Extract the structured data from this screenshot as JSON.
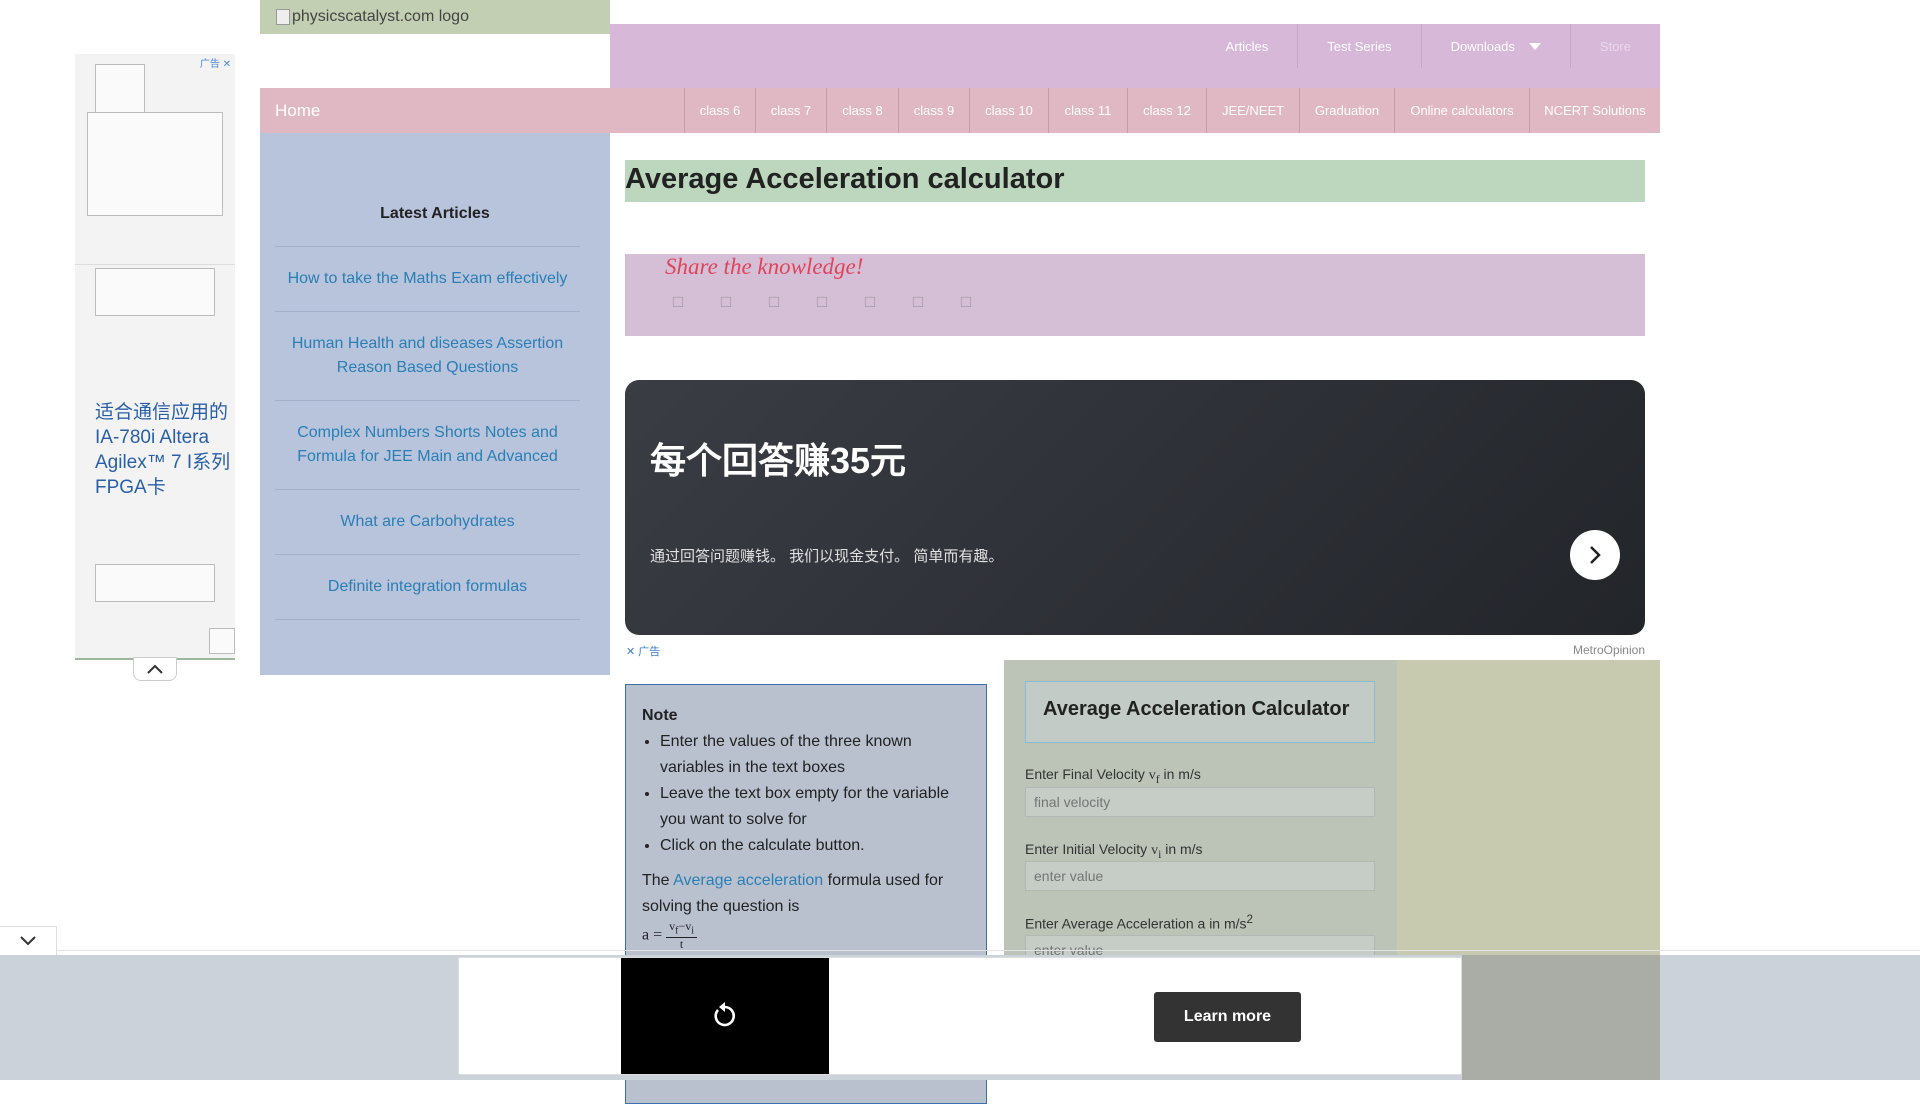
{
  "logo": {
    "alt": "physicscatalyst.com logo"
  },
  "top_nav": {
    "items": [
      "Articles",
      "Test Series",
      "Downloads",
      "Store"
    ]
  },
  "secondary_nav": {
    "home": "Home",
    "items": [
      "class 6",
      "class 7",
      "class 8",
      "class 9",
      "class 10",
      "class 11",
      "class 12",
      "JEE/NEET",
      "Graduation",
      "Online calculators",
      "NCERT Solutions"
    ]
  },
  "sidebar": {
    "title": "Latest Articles",
    "articles": [
      "How to take the Maths Exam effectively",
      "Human Health and diseases Assertion Reason Based Questions",
      "Complex Numbers Shorts Notes and Formula for JEE Main and Advanced",
      "What are Carbohydrates",
      "Definite integration formulas"
    ]
  },
  "left_ad": {
    "badge": "广告",
    "text": "适合通信应用的IA-780i Altera Agilex™ 7 I系列FPGA卡"
  },
  "main": {
    "title": "Average Acceleration calculator",
    "share_label": "Share the knowledge!",
    "share_icons": [
      "facebook-icon",
      "twitter-icon",
      "linkedin-icon",
      "pinterest-icon",
      "whatsapp-icon",
      "reddit-icon",
      "email-icon"
    ]
  },
  "promo_ad": {
    "headline": "每个回答赚35元",
    "subtext": "通过回答问题赚钱。 我们以现金支付。 简单而有趣。",
    "badge": "广告",
    "brand": "MetroOpinion"
  },
  "note": {
    "title": "Note",
    "bullets": [
      "Enter the values of the three known variables in the text boxes",
      "Leave the text box empty for the variable you want to solve for",
      "Click on the calculate button."
    ],
    "formula_intro": "The",
    "formula_link": "Average acceleration",
    "formula_rest": "formula used for solving the question is",
    "formula_lhs": "a =",
    "formula_num": "v",
    "formula_den": "t"
  },
  "calculator": {
    "title": "Average Acceleration Calculator",
    "fields": [
      {
        "label_prefix": "Enter Final Velocity",
        "var": "v",
        "sub": "f",
        "label_suffix": "in m/s",
        "placeholder": "final velocity"
      },
      {
        "label_prefix": "Enter Initial Velocity",
        "var": "v",
        "sub": "i",
        "label_suffix": "in m/s",
        "placeholder": "enter value"
      },
      {
        "label_prefix": "Enter Average Acceleration a in m/s",
        "var": "",
        "sub": "",
        "label_suffix": "",
        "placeholder": "enter value"
      }
    ]
  },
  "bottom_ad": {
    "cta": "Learn more"
  }
}
